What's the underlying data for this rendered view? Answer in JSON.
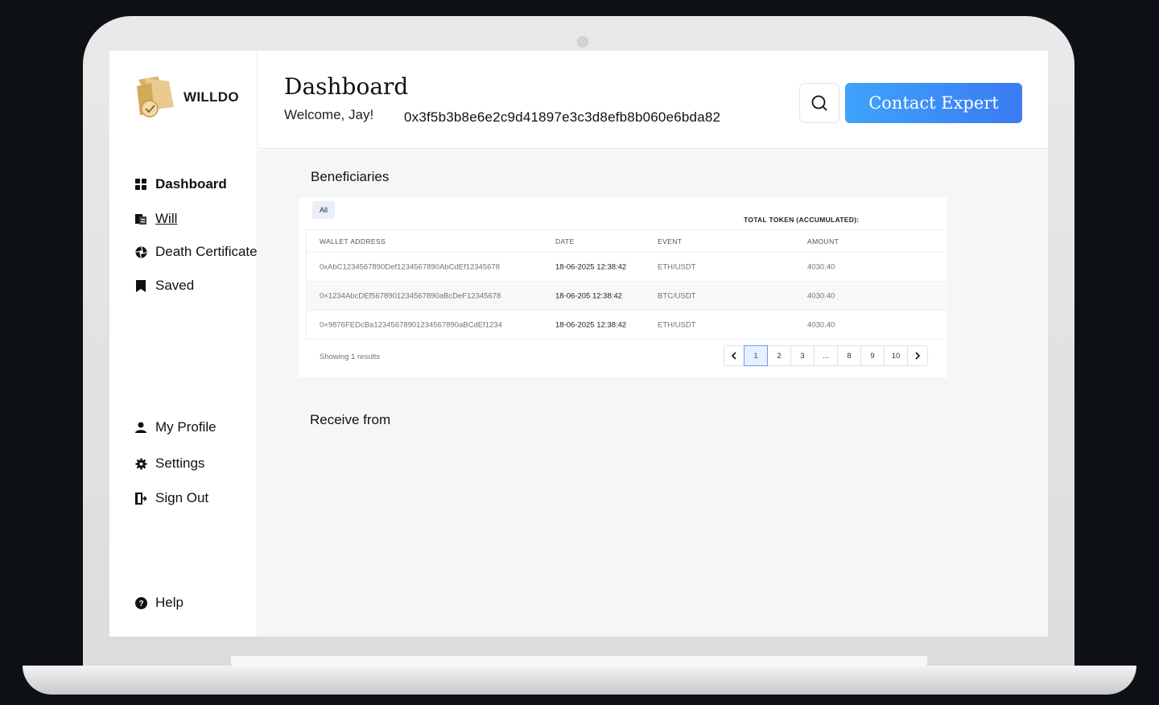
{
  "brand": {
    "name": "WILLDO"
  },
  "sidebar": {
    "items": [
      {
        "label": "Dashboard",
        "icon": "grid-icon"
      },
      {
        "label": "Will",
        "icon": "document-icon"
      },
      {
        "label": "Death Certificate",
        "icon": "aperture-icon"
      },
      {
        "label": "Saved",
        "icon": "bookmark-icon"
      },
      {
        "label": "My Profile",
        "icon": "user-icon"
      },
      {
        "label": "Settings",
        "icon": "gear-icon"
      },
      {
        "label": "Sign Out",
        "icon": "signout-icon"
      },
      {
        "label": "Help",
        "icon": "help-icon"
      }
    ]
  },
  "header": {
    "title": "Dashboard",
    "welcome": "Welcome, Jay!",
    "wallet": "0x3f5b3b8e6e2c9d41897e3c3d8efb8b060e6bda82",
    "contact_label": "Contact Expert"
  },
  "beneficiaries": {
    "title": "Beneficiaries",
    "filter_tab": "All",
    "total_label": "TOTAL TOKEN  (ACCUMULATED):",
    "columns": [
      "WALLET ADDRESS",
      "DATE",
      "EVENT",
      "AMOUNT"
    ],
    "rows": [
      {
        "wallet": "0xAbC1234567890Def1234567890AbCdEf12345678",
        "date": "18-06-2025 12:38:42",
        "event": "ETH/USDT",
        "amount": "4030.40"
      },
      {
        "wallet": "0×1234AbcDEf5678901234567890aBcDeF12345678",
        "date": "18-06-205 12:38:42",
        "event": "BTC/USDT",
        "amount": "4030.40"
      },
      {
        "wallet": "0×9876FEDcBa12345678901234567890aBCdEf1234",
        "date": "18-06-2025 12:38:42",
        "event": "ETH/USDT",
        "amount": "4030.40"
      }
    ],
    "showing": "Showing 1  results",
    "pages": [
      "1",
      "2",
      "3",
      "...",
      "8",
      "9",
      "10"
    ],
    "active_page": "1"
  },
  "receive": {
    "title": "Receive from"
  },
  "colors": {
    "accent": "#3a8ef6",
    "brand_gold": "#e8c98a"
  }
}
